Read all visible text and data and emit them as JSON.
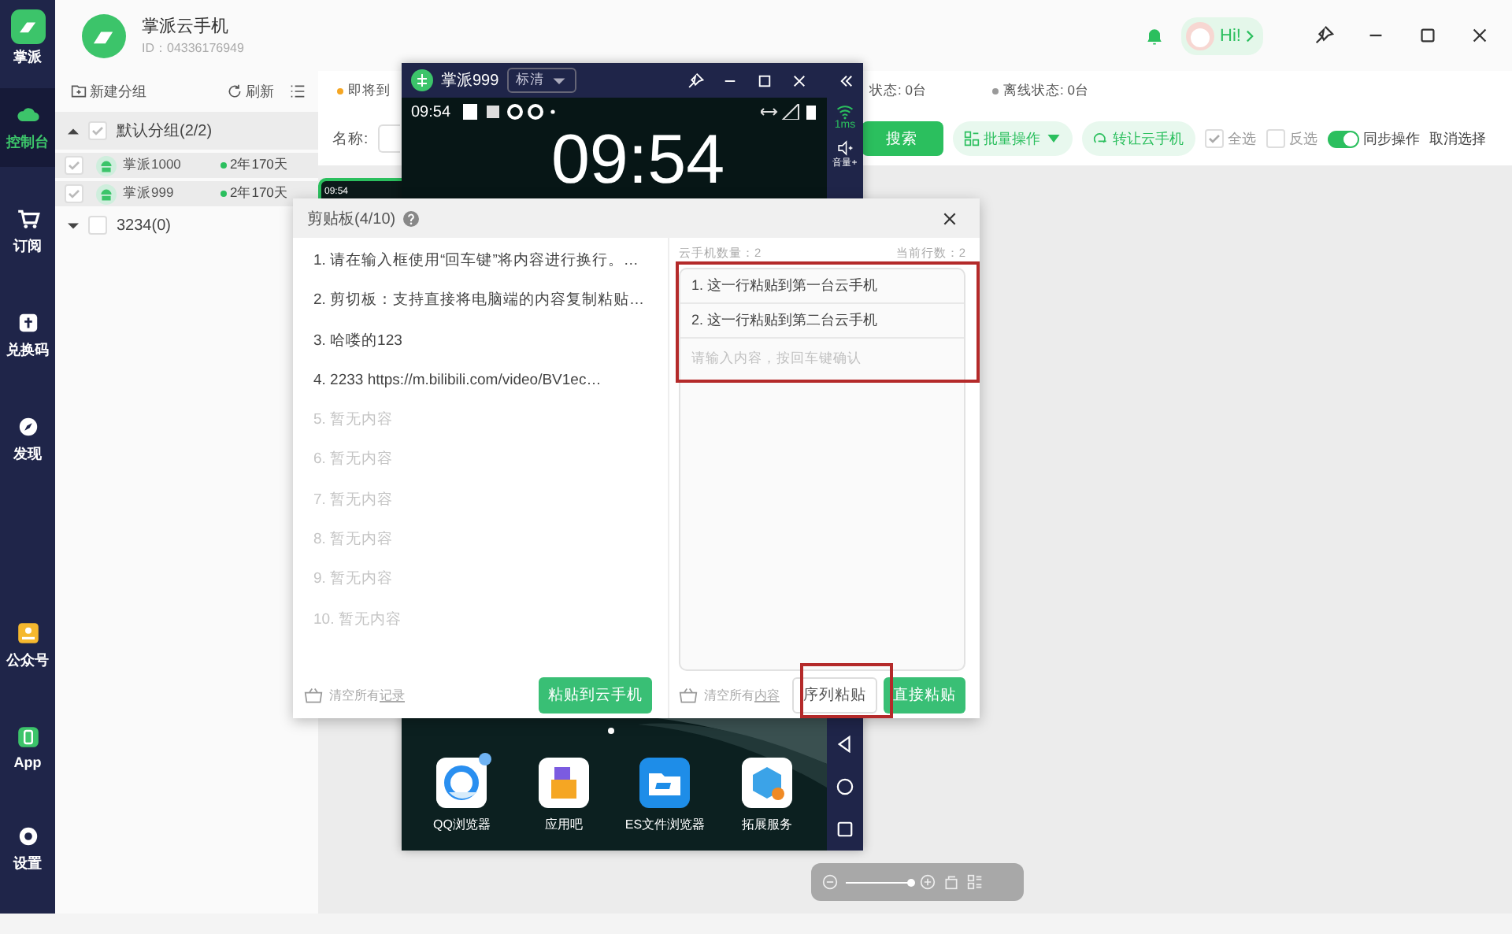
{
  "sidebar": {
    "brand": "掌派",
    "items": [
      {
        "label": "控制台",
        "selected": true
      },
      {
        "label": "订阅",
        "selected": false
      },
      {
        "label": "兑换码",
        "selected": false
      },
      {
        "label": "发现",
        "selected": false
      }
    ],
    "bottom_items": [
      {
        "label": "公众号",
        "selected": false
      },
      {
        "label": "App",
        "selected": false
      },
      {
        "label": "设置",
        "selected": false
      }
    ]
  },
  "header": {
    "title": "掌派云手机",
    "id": "ID：04336176949",
    "greeting": "Hi!"
  },
  "groups_panel": {
    "new_group": "新建分组",
    "refresh": "刷新",
    "groups": [
      {
        "name": "默认分组(2/2)",
        "expanded": true,
        "checked": true,
        "devices": [
          {
            "name": "掌派1000",
            "remaining": "2年170天",
            "checked": true
          },
          {
            "name": "掌派999",
            "remaining": "2年170天",
            "checked": true
          }
        ]
      },
      {
        "name": "3234(0)",
        "expanded": false,
        "checked": false
      }
    ]
  },
  "status_strip": [
    {
      "text": "即将到",
      "color": "#f5a623"
    },
    {
      "text": "状态: 0台"
    },
    {
      "text": "离线状态: 0台",
      "color": "#9a9a9a"
    }
  ],
  "toolbar": {
    "name_label": "名称:",
    "search": "搜索",
    "batch": "批量操作",
    "transfer": "转让云手机",
    "select_all": {
      "label": "全选",
      "checked": true
    },
    "invert": {
      "label": "反选",
      "checked": false
    },
    "sync": {
      "label": "同步操作",
      "on": true
    },
    "cancel": "取消选择"
  },
  "thumbnail": {
    "time": "09:54"
  },
  "zoom": {
    "level": 1
  },
  "phone_window": {
    "title": "掌派999",
    "quality": "标清",
    "status_time": "09:54",
    "clock": "09:54",
    "latency": "1ms",
    "volume": "音量+",
    "apps": [
      {
        "label": "QQ浏览器",
        "badge": true
      },
      {
        "label": "应用吧",
        "badge": false
      },
      {
        "label": "ES文件浏览器",
        "badge": false
      },
      {
        "label": "拓展服务",
        "badge": false
      }
    ]
  },
  "clipboard": {
    "title": "剪贴板(4/10)",
    "items": [
      {
        "text": "1. 请在输入框使用“回车键”将内容进行换行。…",
        "empty": false
      },
      {
        "text": "2. 剪切板：支持直接将电脑端的内容复制粘贴…",
        "empty": false
      },
      {
        "text": "3. 哈喽的123",
        "empty": false
      },
      {
        "text": "4. 2233 https://m.bilibili.com/video/BV1ec…",
        "empty": false
      },
      {
        "text": "5. 暂无内容",
        "empty": true
      },
      {
        "text": "6. 暂无内容",
        "empty": true
      },
      {
        "text": "7. 暂无内容",
        "empty": true
      },
      {
        "text": "8. 暂无内容",
        "empty": true
      },
      {
        "text": "9. 暂无内容",
        "empty": true
      },
      {
        "text": "10. 暂无内容",
        "empty": true
      }
    ],
    "clear_history_prefix": "清空所有",
    "clear_history_link": "记录",
    "paste_to_phone": "粘贴到云手机",
    "phone_count": "云手机数量：2",
    "line_count": "当前行数：2",
    "lines": [
      "1. 这一行粘贴到第一台云手机",
      "2. 这一行粘贴到第二台云手机"
    ],
    "input_placeholder": "请输入内容，按回车键确认",
    "clear_content_prefix": "清空所有",
    "clear_content_link": "内容",
    "sequence_paste": "序列粘贴",
    "direct_paste": "直接粘贴"
  }
}
